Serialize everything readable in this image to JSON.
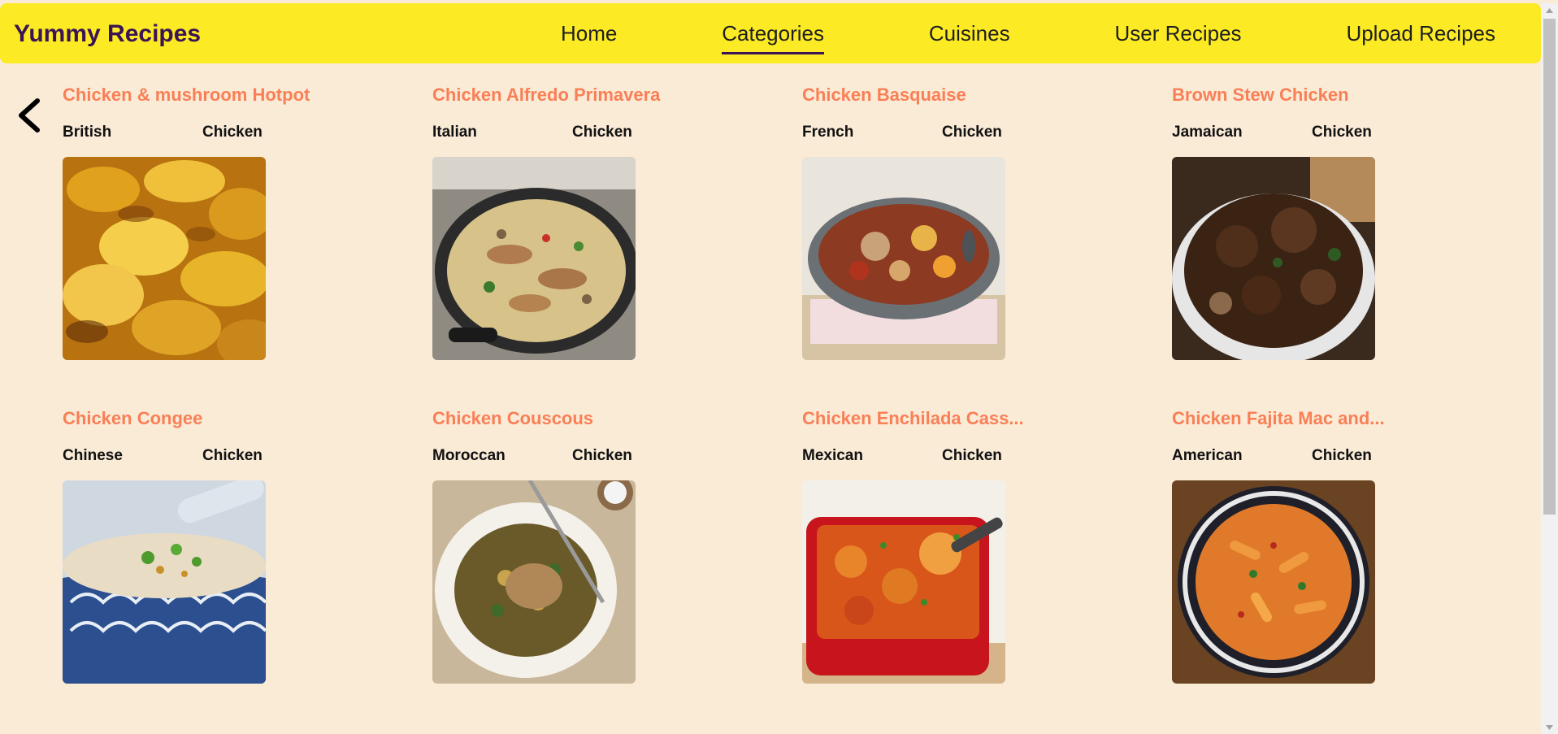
{
  "app": {
    "brand": "Yummy Recipes"
  },
  "nav": {
    "items": [
      {
        "label": "Home",
        "active": false
      },
      {
        "label": "Categories",
        "active": true
      },
      {
        "label": "Cuisines",
        "active": false
      },
      {
        "label": "User Recipes",
        "active": false
      },
      {
        "label": "Upload Recipes",
        "active": false
      }
    ]
  },
  "colors": {
    "navbar_bg": "#fceb24",
    "brand_text": "#3a1454",
    "page_bg": "#faebd7",
    "recipe_title": "#f97f56",
    "active_underline": "#3a1454"
  },
  "icons": {
    "back": "chevron-left-icon"
  },
  "recipes": [
    {
      "title": "Chicken & mushroom Hotpot",
      "cuisine": "British",
      "category": "Chicken",
      "image": "hotpot-photo"
    },
    {
      "title": "Chicken Alfredo Primavera",
      "cuisine": "Italian",
      "category": "Chicken",
      "image": "alfredo-photo"
    },
    {
      "title": "Chicken Basquaise",
      "cuisine": "French",
      "category": "Chicken",
      "image": "basquaise-photo"
    },
    {
      "title": "Brown Stew Chicken",
      "cuisine": "Jamaican",
      "category": "Chicken",
      "image": "stew-photo"
    },
    {
      "title": "Chicken Congee",
      "cuisine": "Chinese",
      "category": "Chicken",
      "image": "congee-photo"
    },
    {
      "title": "Chicken Couscous",
      "cuisine": "Moroccan",
      "category": "Chicken",
      "image": "couscous-photo"
    },
    {
      "title": "Chicken Enchilada Cass...",
      "cuisine": "Mexican",
      "category": "Chicken",
      "image": "enchilada-photo"
    },
    {
      "title": "Chicken Fajita Mac and...",
      "cuisine": "American",
      "category": "Chicken",
      "image": "fajita-mac-photo"
    }
  ]
}
